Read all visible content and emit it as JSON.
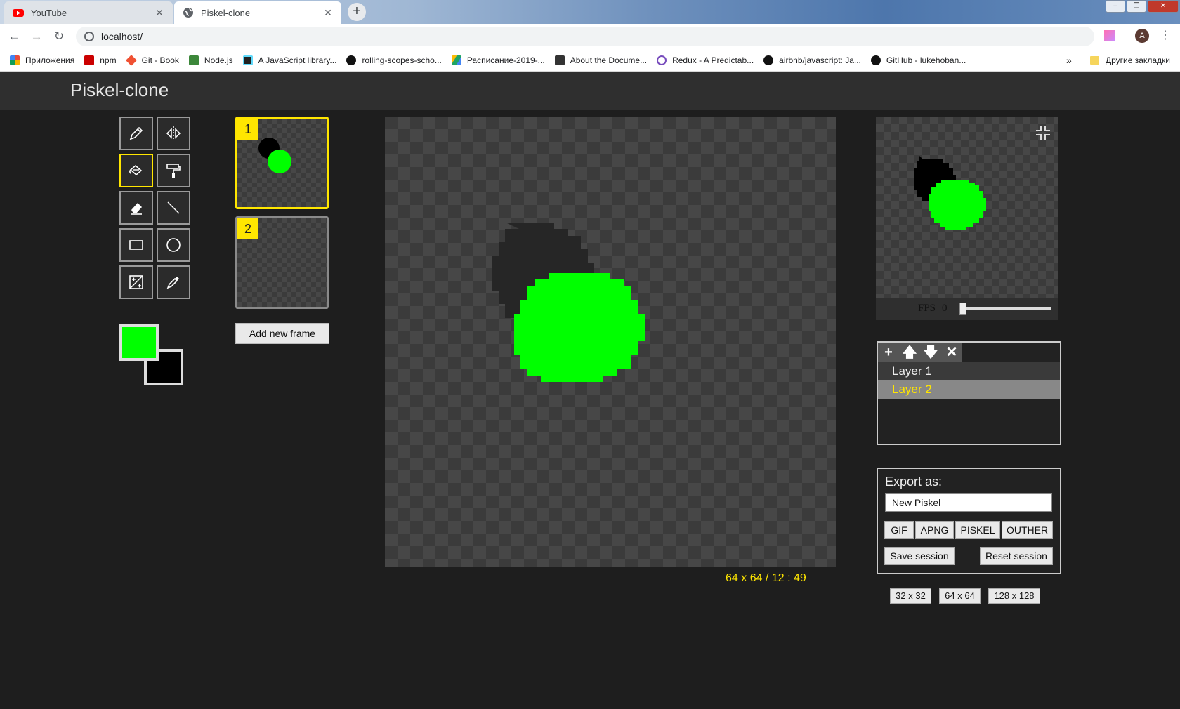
{
  "browser": {
    "tabs": [
      {
        "title": "YouTube",
        "icon": "youtube-icon"
      },
      {
        "title": "Piskel-clone",
        "icon": "globe-icon"
      }
    ],
    "url": "localhost/",
    "avatar_letter": "A",
    "bookmarks": [
      {
        "label": "Приложения",
        "color": "#e84b3c"
      },
      {
        "label": "npm",
        "color": "#cb0000"
      },
      {
        "label": "Git - Book",
        "color": "#f05133"
      },
      {
        "label": "Node.js",
        "color": "#3c873a"
      },
      {
        "label": "A JavaScript library...",
        "color": "#222222"
      },
      {
        "label": "rolling-scopes-scho...",
        "color": "#111111"
      },
      {
        "label": "Расписание-2019-...",
        "color": "#1fa463"
      },
      {
        "label": "About the Docume...",
        "color": "#333333"
      },
      {
        "label": "Redux - A Predictab...",
        "color": "#764abc"
      },
      {
        "label": "airbnb/javascript: Ja...",
        "color": "#111111"
      },
      {
        "label": "GitHub - lukehoban...",
        "color": "#111111"
      }
    ],
    "more_glyph": "»",
    "other_bookmarks": "Другие закладки"
  },
  "app": {
    "title": "Piskel-clone",
    "tools": [
      {
        "name": "pencil",
        "selected": false
      },
      {
        "name": "mirror-pen",
        "selected": false
      },
      {
        "name": "paint-bucket",
        "selected": true
      },
      {
        "name": "paint-roller",
        "selected": false
      },
      {
        "name": "eraser",
        "selected": false
      },
      {
        "name": "stroke",
        "selected": false
      },
      {
        "name": "rectangle",
        "selected": false
      },
      {
        "name": "circle",
        "selected": false
      },
      {
        "name": "lighten",
        "selected": false
      },
      {
        "name": "color-picker",
        "selected": false
      }
    ],
    "colors": {
      "primary": "#00ff00",
      "secondary": "#000000"
    },
    "frames": [
      {
        "number": "1",
        "selected": true
      },
      {
        "number": "2",
        "selected": false
      }
    ],
    "add_frame_label": "Add new frame",
    "coords": "64 x 64 / 12 : 49",
    "fps_label": "FPS",
    "fps_value": "0",
    "layers": [
      {
        "name": "Layer 1",
        "selected": false
      },
      {
        "name": "Layer 2",
        "selected": true
      }
    ],
    "layer_tools": [
      "+",
      "🡅",
      "🡇",
      "✕"
    ],
    "export": {
      "title": "Export as:",
      "filename": "New Piskel",
      "formats": [
        "GIF",
        "APNG",
        "PISKEL",
        "OUTHER"
      ],
      "save_label": "Save session",
      "reset_label": "Reset session"
    },
    "sizes": [
      "32 x 32",
      "64 x 64",
      "128 x 128"
    ]
  }
}
